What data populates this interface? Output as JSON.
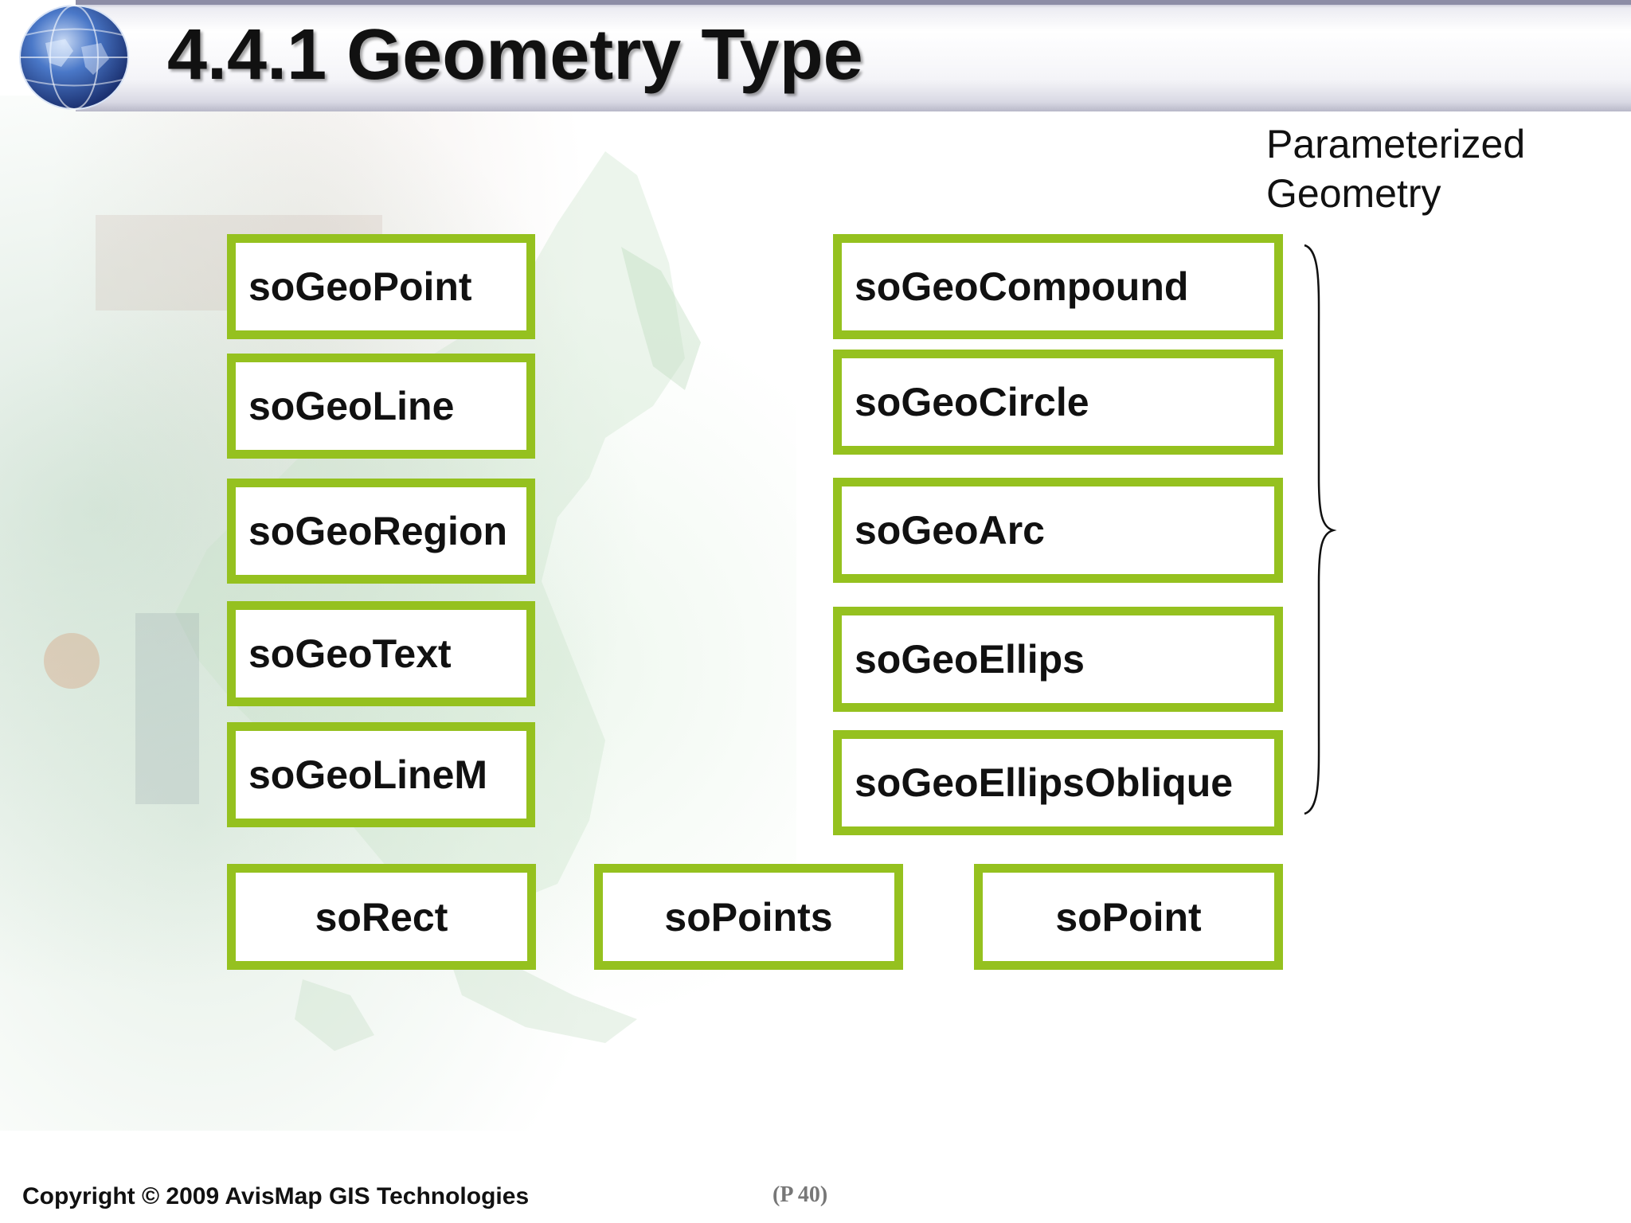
{
  "header": {
    "title": "4.4.1 Geometry Type",
    "logo_icon": "globe-icon"
  },
  "left_column": [
    {
      "label": "soGeoPoint"
    },
    {
      "label": "soGeoLine"
    },
    {
      "label": "soGeoRegion"
    },
    {
      "label": "soGeoText"
    },
    {
      "label": "soGeoLineM"
    }
  ],
  "right_column": [
    {
      "label": "soGeoCompound"
    },
    {
      "label": "soGeoCircle"
    },
    {
      "label": "soGeoArc"
    },
    {
      "label": "soGeoEllips"
    },
    {
      "label": "soGeoEllipsOblique"
    }
  ],
  "bottom_row": [
    {
      "label": "soRect"
    },
    {
      "label": "soPoints"
    },
    {
      "label": "soPoint"
    }
  ],
  "brace_label": "Parameterized Geometry",
  "footer": {
    "copyright": "Copyright © 2009 AvisMap GIS Technologies",
    "page_number": "(P 40)"
  },
  "colors": {
    "box_border": "#95c11f",
    "text": "#111111"
  }
}
